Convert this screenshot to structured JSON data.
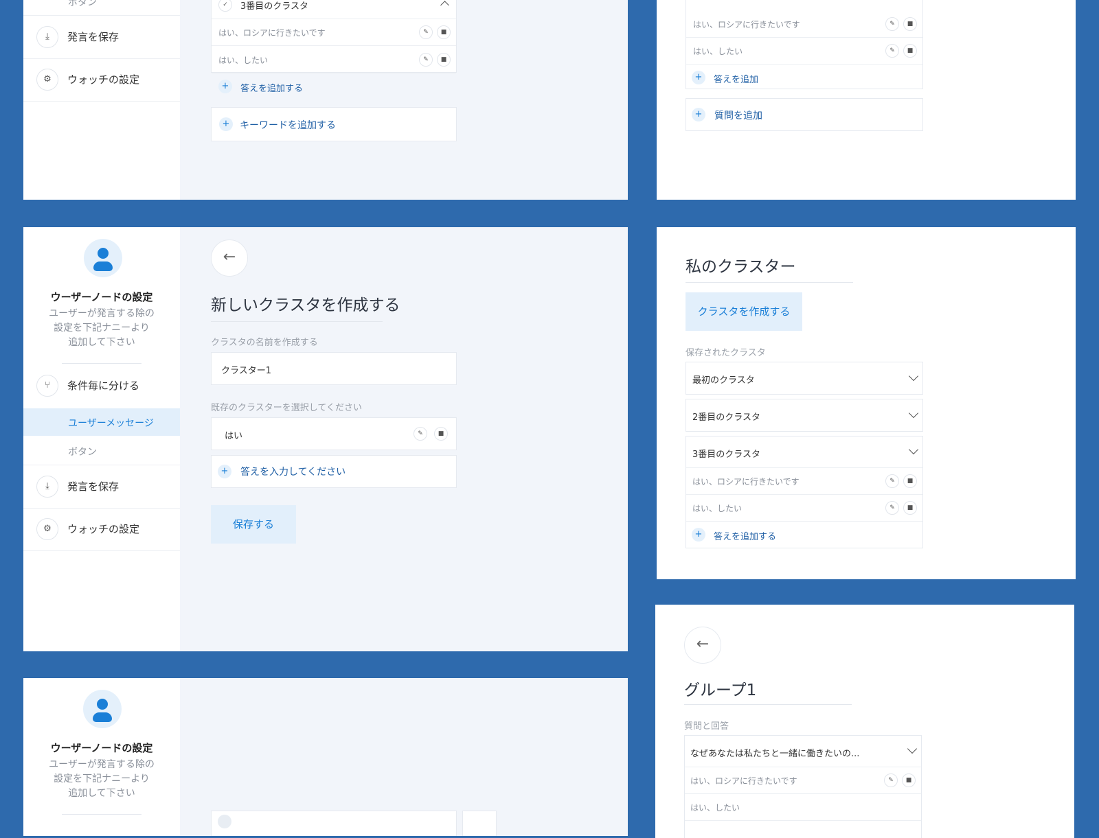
{
  "sidebar": {
    "title": "ウーザーノードの設定",
    "desc": [
      "ユーザーが発言する除の",
      "設定を下記ナニーより",
      "追加して下さい"
    ],
    "items": {
      "split": "条件毎に分ける",
      "user_message": "ユーザーメッセージ",
      "button": "ボタン",
      "save_speech": "発言を保存",
      "watch_settings": "ウォッチの設定"
    }
  },
  "top_left": {
    "cluster_title": "3番目のクラスタ",
    "answers": [
      "はい、ロシアに行きたいです",
      "はい、したい"
    ],
    "add_answer": "答えを追加する",
    "add_keyword": "キーワードを追加する"
  },
  "top_right": {
    "answers": [
      "はい、ロシアに行きたいです",
      "はい、したい"
    ],
    "add_answer": "答えを追加",
    "add_question": "質問を追加"
  },
  "create": {
    "title": "新しいクラスタを作成する",
    "name_label": "クラスタの名前を作成する",
    "name_value": "クラスター1",
    "select_label": "既存のクラスターを選択してください",
    "selected": "はい",
    "enter_answer": "答えを入力してください",
    "save": "保存する"
  },
  "my_clusters": {
    "title": "私のクラスター",
    "create_button": "クラスタを作成する",
    "saved_label": "保存されたクラスタ",
    "clusters": [
      "最初のクラスタ",
      "2番目のクラスタ",
      "3番目のクラスタ"
    ],
    "answers": [
      "はい、ロシアに行きたいです",
      "はい、したい"
    ],
    "add_answer": "答えを追加する"
  },
  "group": {
    "title": "グループ1",
    "qa_label": "質問と回答",
    "question": "なぜあなたは私たちと一緒に働きたいの...",
    "answers": [
      "はい、ロシアに行きたいです",
      "はい、したい"
    ]
  },
  "icons": {
    "edit": "pencil-icon",
    "delete": "trash-icon",
    "add": "plus-icon",
    "back": "arrow-left-icon",
    "split": "branch-icon",
    "save": "save-icon",
    "settings": "gear-icon",
    "chevron": "chevron-down-icon"
  },
  "colors": {
    "background": "#2e6aad",
    "accent": "#1a7fd7",
    "accent_light": "#e2effb"
  }
}
